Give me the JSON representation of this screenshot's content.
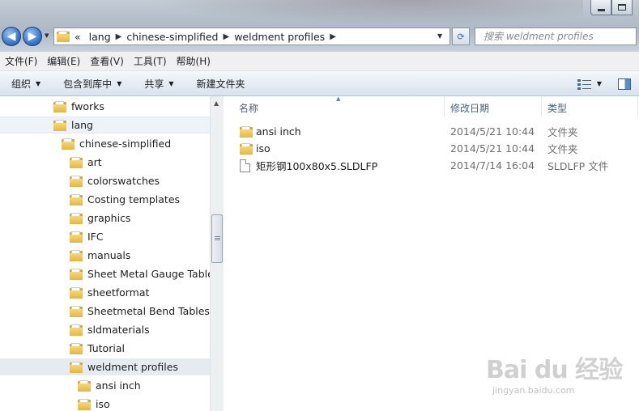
{
  "window": {
    "minimize_label": "minimize",
    "maximize_label": "maximize"
  },
  "nav": {
    "back": "◀",
    "forward": "▶"
  },
  "address": {
    "overflow": "«",
    "crumbs": [
      "lang",
      "chinese-simplified",
      "weldment profiles"
    ],
    "separator": "▶",
    "refresh": "⟳"
  },
  "search": {
    "placeholder": "搜索 weldment profiles"
  },
  "menubar": {
    "items": [
      "文件(F)",
      "编辑(E)",
      "查看(V)",
      "工具(T)",
      "帮助(H)"
    ]
  },
  "toolbar": {
    "organize": "组织",
    "include_in_library": "包含到库中",
    "share": "共享",
    "new_folder": "新建文件夹"
  },
  "tree": {
    "items": [
      {
        "label": "fworks",
        "level": 0
      },
      {
        "label": "lang",
        "level": 0
      },
      {
        "label": "chinese-simplified",
        "level": 1
      },
      {
        "label": "art",
        "level": 2
      },
      {
        "label": "colorswatches",
        "level": 2
      },
      {
        "label": "Costing templates",
        "level": 2
      },
      {
        "label": "graphics",
        "level": 2
      },
      {
        "label": "IFC",
        "level": 2
      },
      {
        "label": "manuals",
        "level": 2
      },
      {
        "label": "Sheet Metal Gauge Tables",
        "level": 2
      },
      {
        "label": "sheetformat",
        "level": 2
      },
      {
        "label": "Sheetmetal Bend Tables",
        "level": 2
      },
      {
        "label": "sldmaterials",
        "level": 2
      },
      {
        "label": "Tutorial",
        "level": 2
      },
      {
        "label": "weldment profiles",
        "level": 2
      },
      {
        "label": "ansi inch",
        "level": 3
      },
      {
        "label": "iso",
        "level": 3
      }
    ]
  },
  "columns": {
    "name": "名称",
    "date_modified": "修改日期",
    "type": "类型"
  },
  "files": [
    {
      "name": "ansi inch",
      "date": "2014/5/21 10:44",
      "type": "文件夹",
      "kind": "folder"
    },
    {
      "name": "iso",
      "date": "2014/5/21 10:44",
      "type": "文件夹",
      "kind": "folder"
    },
    {
      "name": "矩形钢100x80x5.SLDLFP",
      "date": "2014/7/14 16:04",
      "type": "SLDLFP 文件",
      "kind": "file"
    }
  ],
  "watermark": {
    "logo": "Bai du 经验",
    "url": "jingyan.baidu.com"
  }
}
